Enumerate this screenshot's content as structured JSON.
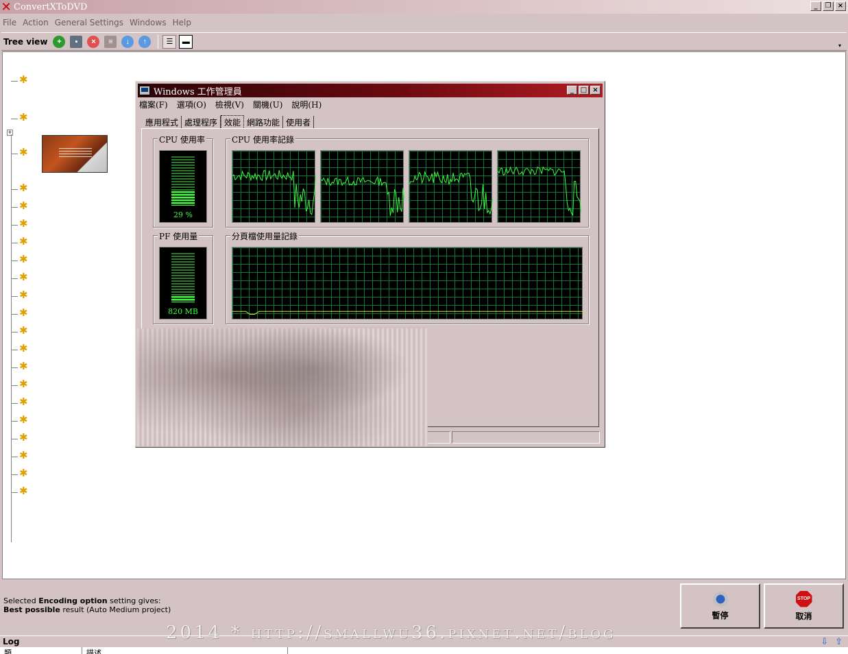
{
  "app": {
    "title": "ConvertXToDVD",
    "window_buttons": [
      "_",
      "❒",
      "×"
    ]
  },
  "menubar": {
    "items": [
      "File",
      "Action",
      "General Settings",
      "Windows",
      "Help"
    ]
  },
  "treeview_toolbar": {
    "label": "Tree view",
    "dropdown": "▾"
  },
  "task_manager": {
    "title": "Windows 工作管理員",
    "menu": [
      "檔案(F)",
      "選項(O)",
      "檢視(V)",
      "關機(U)",
      "說明(H)"
    ],
    "tabs": [
      "應用程式",
      "處理程序",
      "效能",
      "網路功能",
      "使用者"
    ],
    "active_tab": "效能",
    "cpu_usage_label": "CPU 使用率",
    "cpu_usage_value": "29 %",
    "cpu_usage_percent": 29,
    "cpu_history_label": "CPU 使用率記錄",
    "pf_usage_label": "PF 使用量",
    "pf_usage_value": "820 MB",
    "pf_usage_fraction": 0.12,
    "pagefile_history_label": "分頁檔使用量記錄",
    "graph_color": "#3cff3c",
    "pf_line_color": "#e0e020"
  },
  "status": {
    "line1_prefix": "Selected ",
    "line1_bold": "Encoding option",
    "line1_suffix": " setting gives:",
    "line2_bold": "Best possible",
    "line2_suffix": " result (Auto Medium project)"
  },
  "buttons": {
    "pause_label": "暫停",
    "cancel_label": "取消",
    "stop_sign_text": "STOP"
  },
  "watermark": "2014 * http://smallwu36.pixnet.net/blog",
  "log": {
    "label": "Log",
    "columns": [
      "類",
      "描述"
    ]
  }
}
